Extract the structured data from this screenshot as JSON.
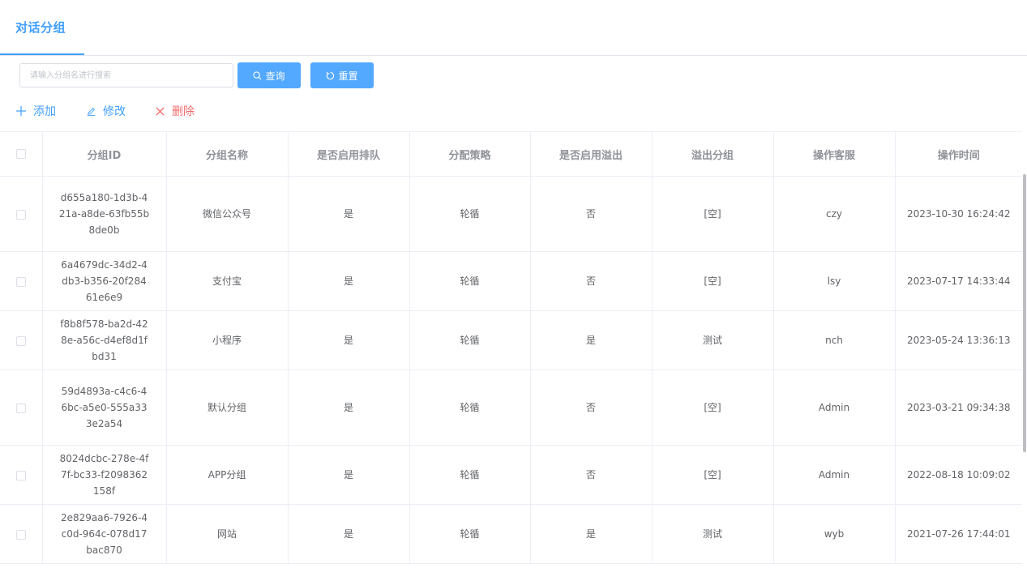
{
  "tab": {
    "label": "对话分组"
  },
  "search": {
    "placeholder": "请输入分组名进行搜索",
    "value": ""
  },
  "buttons": {
    "query": "查询",
    "reset": "重置"
  },
  "actions": {
    "add": "添加",
    "edit": "修改",
    "delete": "删除"
  },
  "colors": {
    "primary": "#409eff",
    "button": "#53a8ff",
    "danger": "#f56c6c"
  },
  "table": {
    "headers": [
      "分组ID",
      "分组名称",
      "是否启用排队",
      "分配策略",
      "是否启用溢出",
      "溢出分组",
      "操作客服",
      "操作时间"
    ],
    "rows": [
      {
        "id": "d655a180-1d3b-421a-a8de-63fb55b8de0b",
        "name": "微信公众号",
        "queue": "是",
        "strategy": "轮循",
        "overflow": "否",
        "overflow_group": "[空]",
        "operator": "czy",
        "time": "2023-10-30 16:24:42"
      },
      {
        "id": "6a4679dc-34d2-4db3-b356-20f28461e6e9",
        "name": "支付宝",
        "queue": "是",
        "strategy": "轮循",
        "overflow": "否",
        "overflow_group": "[空]",
        "operator": "lsy",
        "time": "2023-07-17 14:33:44"
      },
      {
        "id": "f8b8f578-ba2d-428e-a56c-d4ef8d1fbd31",
        "name": "小程序",
        "queue": "是",
        "strategy": "轮循",
        "overflow": "是",
        "overflow_group": "测试",
        "operator": "nch",
        "time": "2023-05-24 13:36:13"
      },
      {
        "id": "59d4893a-c4c6-46bc-a5e0-555a333e2a54",
        "name": "默认分组",
        "queue": "是",
        "strategy": "轮循",
        "overflow": "否",
        "overflow_group": "[空]",
        "operator": "Admin",
        "time": "2023-03-21 09:34:38"
      },
      {
        "id": "8024dcbc-278e-4f7f-bc33-f2098362158f",
        "name": "APP分组",
        "queue": "是",
        "strategy": "轮循",
        "overflow": "否",
        "overflow_group": "[空]",
        "operator": "Admin",
        "time": "2022-08-18 10:09:02"
      },
      {
        "id": "2e829aa6-7926-4c0d-964c-078d17bac870",
        "name": "网站",
        "queue": "是",
        "strategy": "轮循",
        "overflow": "是",
        "overflow_group": "测试",
        "operator": "wyb",
        "time": "2021-07-26 17:44:01"
      }
    ]
  }
}
